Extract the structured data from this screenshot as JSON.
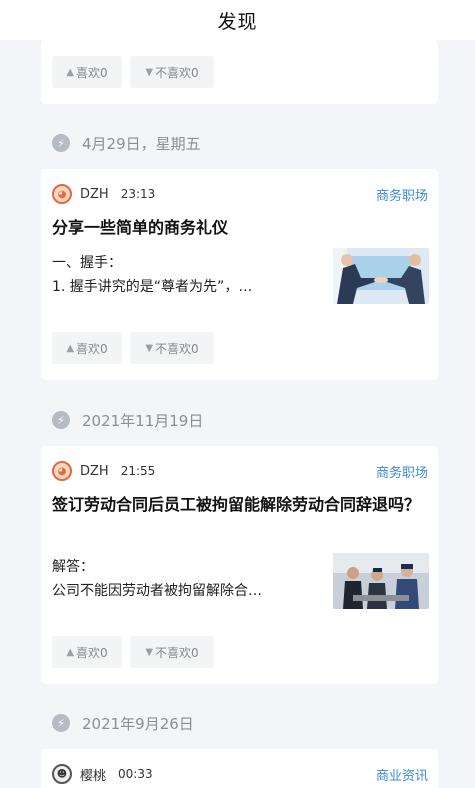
{
  "header": {
    "title": "发现"
  },
  "reactions": {
    "like": "喜欢0",
    "dislike": "不喜欢0"
  },
  "groups": [
    {
      "date": "4月29日，星期五",
      "post": {
        "author": "DZH",
        "time": "23:13",
        "category": "商务职场",
        "title": "分享一些简单的商务礼仪",
        "excerpt": [
          "一、握手：",
          "1. 握手讲究的是“尊者为先”，…"
        ],
        "thumb_icon": "handshake-photo"
      }
    },
    {
      "date": "2021年11月19日",
      "post": {
        "author": "DZH",
        "time": "21:55",
        "category": "商务职场",
        "title": "签订劳动合同后员工被拘留能解除劳动合同辞退吗？",
        "excerpt": [
          "解答：",
          "公司不能因劳动者被拘留解除合…"
        ],
        "thumb_icon": "police-photo"
      }
    },
    {
      "date": "2021年9月26日",
      "post": {
        "author": "樱桃",
        "time": "00:33",
        "category": "商业资讯"
      }
    }
  ],
  "colors": {
    "accent": "#3a8bd8",
    "background": "#f3f5f8",
    "muted": "#8a8f96"
  }
}
